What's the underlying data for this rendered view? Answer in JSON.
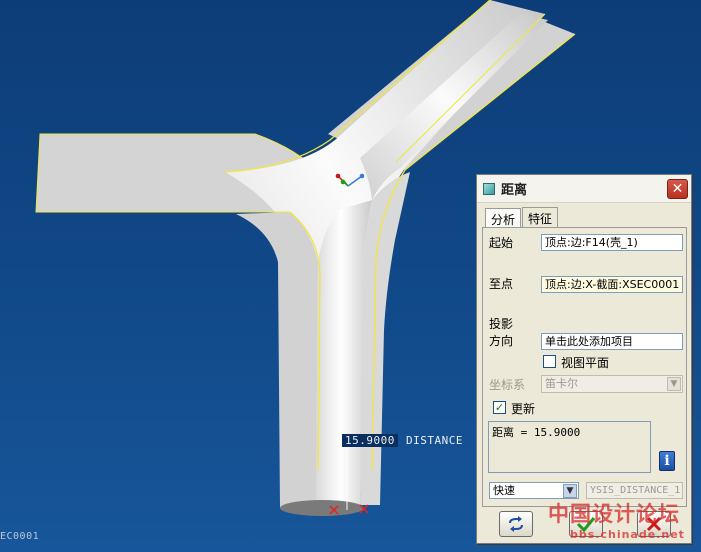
{
  "viewport": {
    "distance_value": "15.9000",
    "distance_tag": "DISTANCE",
    "section_label": "EC0001"
  },
  "dialog": {
    "title": "距离",
    "close_glyph": "✕",
    "tabs": [
      "分析",
      "特征"
    ],
    "from_label": "起始",
    "from_value": "顶点:边:F14(壳_1)",
    "to_label": "至点",
    "to_value": "顶点:边:X-截面:XSEC0001",
    "projection_label": "投影",
    "direction_label": "方向",
    "direction_value": "单击此处添加项目",
    "view_plane_label": "视图平面",
    "view_plane_checked": false,
    "coord_label": "坐标系",
    "coord_value": "笛卡尔",
    "update_label": "更新",
    "update_checked": true,
    "result_text": "距离 = 15.9000",
    "mode_value": "快速",
    "name_value": "YSIS_DISTANCE_1",
    "buttons": {
      "repeat_icon": "repeat-icon",
      "ok_icon": "checkmark-icon",
      "cancel_icon": "x-icon"
    }
  },
  "watermark": {
    "main": "中国设计论坛",
    "sub": "bbs.chinade.net"
  },
  "colors": {
    "background": "#104786",
    "edge_highlight": "#f2e640",
    "accent_red": "#d62828"
  }
}
